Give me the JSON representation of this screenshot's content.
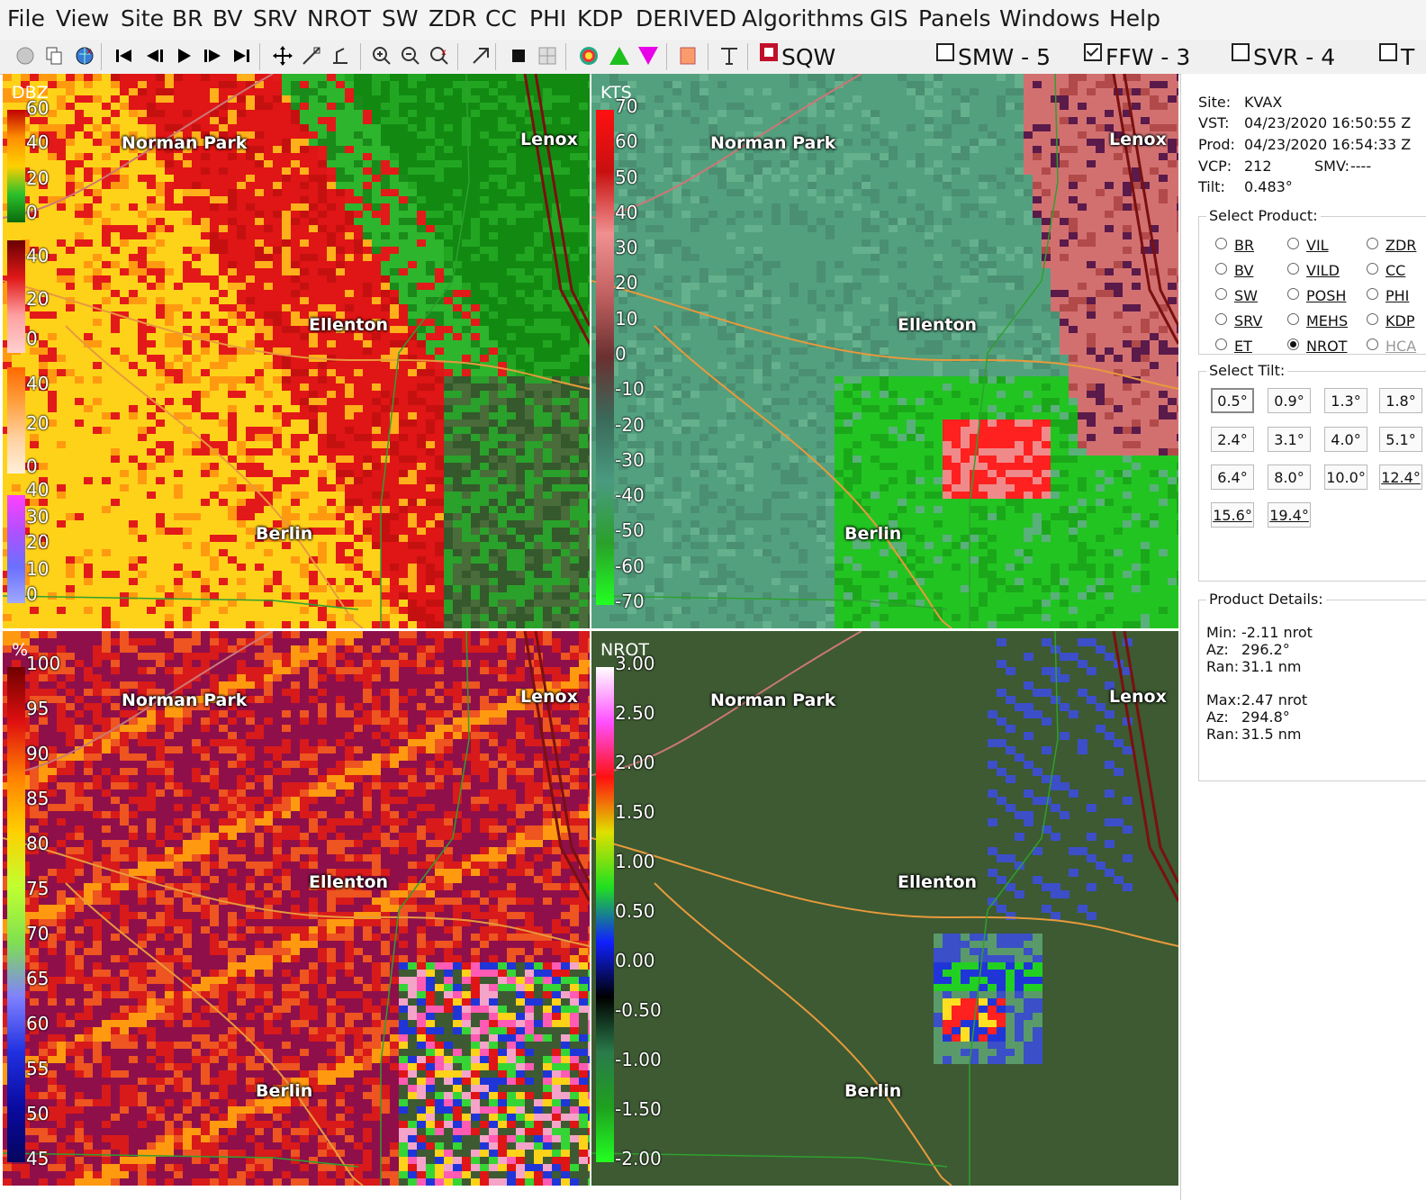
{
  "menu": [
    "File",
    "View",
    "Site",
    "BR",
    "BV",
    "SRV",
    "NROT",
    "SW",
    "ZDR",
    "CC",
    "PHI",
    "KDP",
    "DERIVED",
    "Algorithms",
    "GIS",
    "Panels",
    "Windows",
    "Help"
  ],
  "toolbar": {
    "icons": [
      "globe-icon",
      "copy-icon",
      "site-globe-icon",
      "first-frame-icon",
      "step-back-icon",
      "play-icon",
      "step-forward-icon",
      "last-frame-icon",
      "pan-icon",
      "measure-icon",
      "probe-icon",
      "zoom-in-icon",
      "zoom-reset-icon",
      "zoom-out-icon",
      "arrow-icon",
      "black-square-icon",
      "grid-icon",
      "color-wheel-icon",
      "green-triangle-icon",
      "magenta-triangle-icon",
      "orange-square-icon",
      "text-icon"
    ],
    "warnings": [
      {
        "label": "SQW",
        "checked": false,
        "color": "#c0102a"
      },
      {
        "label": "SMW - 5",
        "checked": false
      },
      {
        "label": "FFW - 3",
        "checked": true
      },
      {
        "label": "SVR - 4",
        "checked": false
      },
      {
        "label": "T",
        "checked": false
      }
    ]
  },
  "panels": [
    {
      "id": "reflectivity",
      "units": "DBZ",
      "ticks": [
        "60",
        "40",
        "20",
        "0",
        "40",
        "20",
        "0",
        "40",
        "20",
        "0",
        "40",
        "30",
        "20",
        "10",
        "0"
      ],
      "towns": [
        "Norman Park",
        "Lenox",
        "Ellenton",
        "Berlin"
      ]
    },
    {
      "id": "velocity",
      "units": "KTS",
      "ticks": [
        "70",
        "60",
        "50",
        "40",
        "30",
        "20",
        "10",
        "0",
        "-10",
        "-20",
        "-30",
        "-40",
        "-50",
        "-60",
        "-70"
      ],
      "towns": [
        "Norman Park",
        "Lenox",
        "Ellenton",
        "Berlin"
      ]
    },
    {
      "id": "correlation",
      "units": "%",
      "ticks": [
        "100",
        "95",
        "90",
        "85",
        "80",
        "75",
        "70",
        "65",
        "60",
        "55",
        "50",
        "45"
      ],
      "towns": [
        "Norman Park",
        "Lenox",
        "Ellenton",
        "Berlin"
      ]
    },
    {
      "id": "nrot",
      "units": "NROT",
      "ticks": [
        "3.00",
        "2.50",
        "2.00",
        "1.50",
        "1.00",
        "0.50",
        "0.00",
        "-0.50",
        "-1.00",
        "-1.50",
        "-2.00"
      ],
      "towns": [
        "Norman Park",
        "Lenox",
        "Ellenton",
        "Berlin"
      ]
    }
  ],
  "info": {
    "site_label": "Site:",
    "site": "KVAX",
    "vst_label": "VST:",
    "vst": "04/23/2020  16:50:55 Z",
    "prod_label": "Prod:",
    "prod": "04/23/2020  16:54:33 Z",
    "vcp_label": "VCP:",
    "vcp": "212",
    "smv_label": "SMV:",
    "smv": "----",
    "tilt_label": "Tilt:",
    "tilt": "0.483°"
  },
  "select_product": {
    "title": "Select Product:",
    "options": [
      {
        "label": "BR",
        "selected": false
      },
      {
        "label": "VIL",
        "selected": false
      },
      {
        "label": "ZDR",
        "selected": false
      },
      {
        "label": "BV",
        "selected": false
      },
      {
        "label": "VILD",
        "selected": false
      },
      {
        "label": "CC",
        "selected": false
      },
      {
        "label": "SW",
        "selected": false
      },
      {
        "label": "POSH",
        "selected": false
      },
      {
        "label": "PHI",
        "selected": false
      },
      {
        "label": "SRV",
        "selected": false
      },
      {
        "label": "MEHS",
        "selected": false
      },
      {
        "label": "KDP",
        "selected": false
      },
      {
        "label": "ET",
        "selected": false
      },
      {
        "label": "NROT",
        "selected": true
      },
      {
        "label": "HCA",
        "selected": false,
        "disabled": true
      }
    ]
  },
  "select_tilt": {
    "title": "Select Tilt:",
    "tilts": [
      "0.5°",
      "0.9°",
      "1.3°",
      "1.8°",
      "2.4°",
      "3.1°",
      "4.0°",
      "5.1°",
      "6.4°",
      "8.0°",
      "10.0°",
      "12.4°",
      "15.6°",
      "19.4°"
    ],
    "selected": "0.5°"
  },
  "product_details": {
    "title": "Product Details:",
    "min_label": "Min:",
    "min": "-2.11 nrot",
    "min_az_label": "Az:",
    "min_az": "296.2°",
    "min_ran_label": "Ran:",
    "min_ran": "31.1 nm",
    "max_label": "Max:",
    "max": "2.47 nrot",
    "max_az_label": "Az:",
    "max_az": "294.8°",
    "max_ran_label": "Ran:",
    "max_ran": "31.5 nm"
  }
}
